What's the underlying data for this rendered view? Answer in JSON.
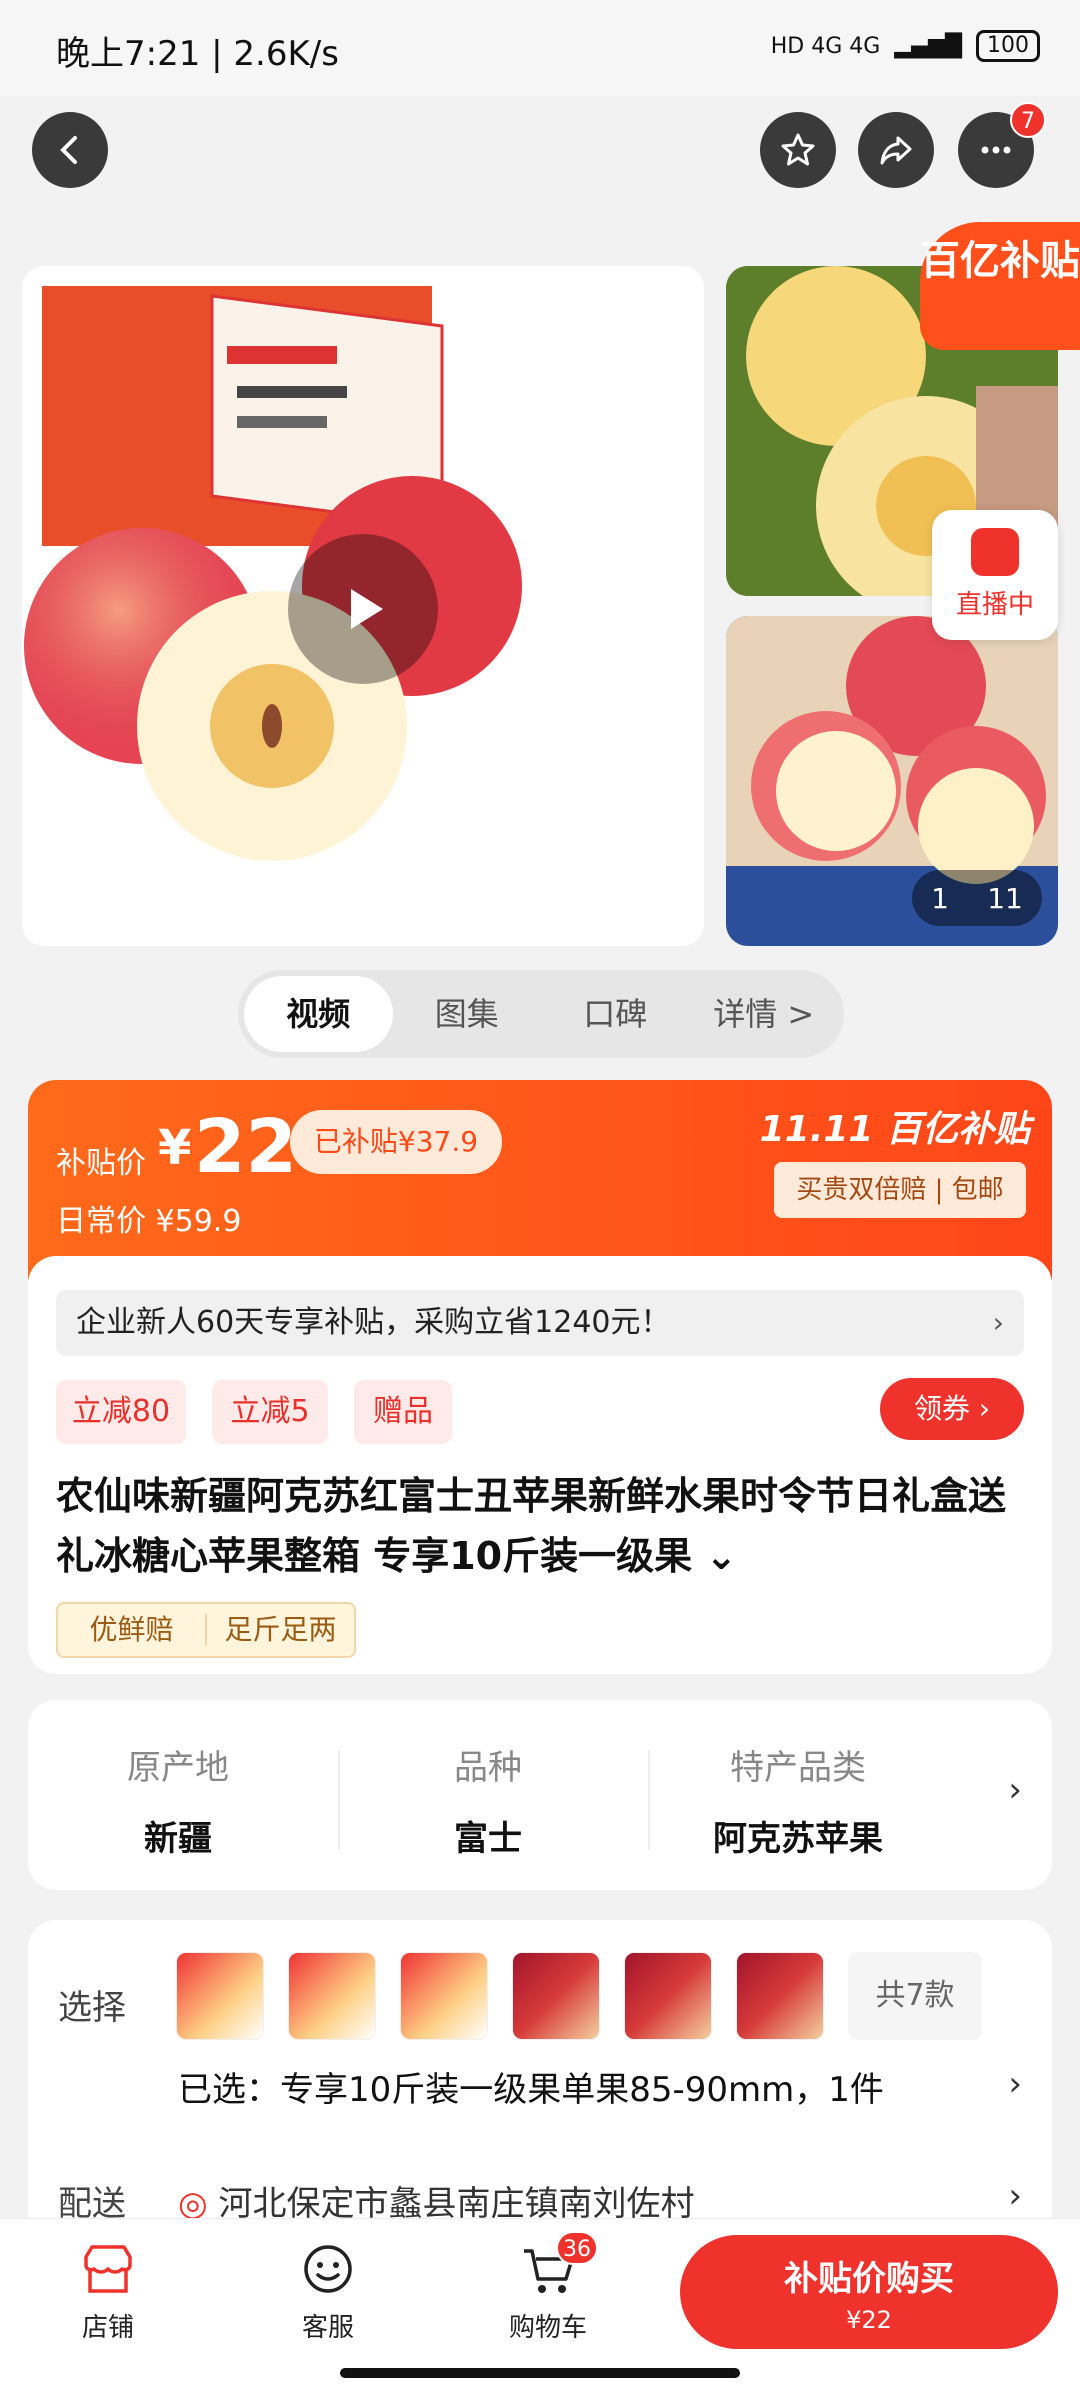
{
  "status_bar": {
    "time": "晚上7:21 | 2.6K/s",
    "network": "HD 4G 4G",
    "battery": "100"
  },
  "header": {
    "more_badge": "7"
  },
  "gallery": {
    "subsidy_tag": "百亿补贴",
    "live_label": "直播中",
    "counter_current": "1",
    "counter_total": "11"
  },
  "tabs": [
    {
      "label": "视频",
      "active": true
    },
    {
      "label": "图集"
    },
    {
      "label": "口碑"
    },
    {
      "label": "详情 >"
    }
  ],
  "price": {
    "subsidy_label": "补贴价",
    "currency": "¥",
    "amount": "22",
    "subsidized": "已补贴¥37.9",
    "daily": "日常价 ¥59.9",
    "brand": "11.11 百亿补贴",
    "perks": "买贵双倍赔 | 包邮"
  },
  "product": {
    "banner": "企业新人60天专享补贴，采购立省1240元！",
    "banner_chevron": "›",
    "coupons": [
      "立减80",
      "立减5",
      "赠品"
    ],
    "get_coupon": "领券 ›",
    "title": "农仙味新疆阿克苏红富士丑苹果新鲜水果时令节日礼盒送礼冰糖心苹果整箱 专享10斤装一级果 ⌄",
    "guarantees": [
      "优鲜赔",
      "足斤足两"
    ]
  },
  "attributes": [
    {
      "key": "原产地",
      "value": "新疆"
    },
    {
      "key": "品种",
      "value": "富士"
    },
    {
      "key": "特产品类",
      "value": "阿克苏苹果"
    }
  ],
  "attributes_chevron": "›",
  "selection": {
    "label": "选择",
    "more": "共7款",
    "selected": "已选：专享10斤装一级果单果85-90mm，1件",
    "chevron": "›",
    "ship_label": "配送",
    "ship_address": "河北保定市蠡县南庄镇南刘佐村",
    "ship_chevron": "›"
  },
  "bottom_bar": {
    "store": "店铺",
    "service": "客服",
    "cart": "购物车",
    "cart_badge": "36",
    "buy_line1": "补贴价购买",
    "buy_line2": "¥22"
  },
  "colors": {
    "accent": "#f0322c",
    "price_orange": "#ff4f1a"
  }
}
